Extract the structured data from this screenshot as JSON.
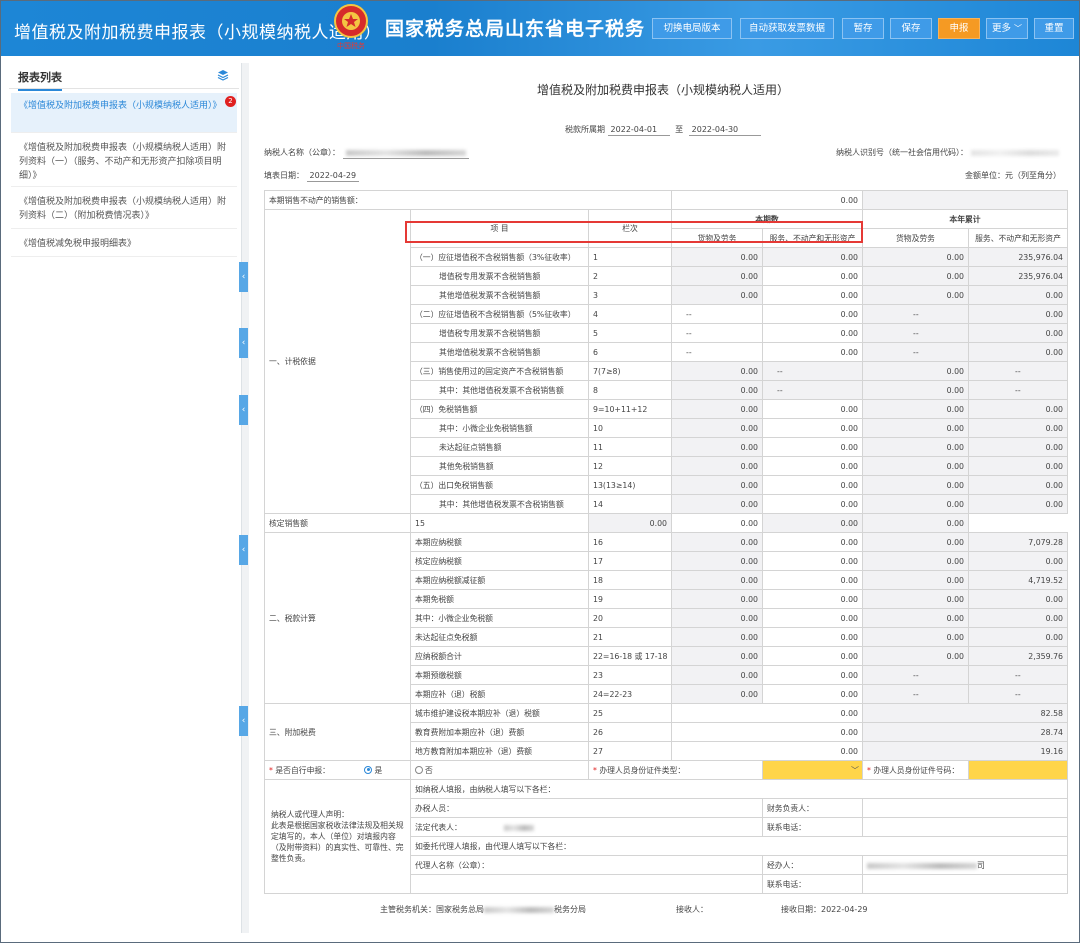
{
  "header": {
    "title": "增值税及附加税费申报表（小规模纳税人适用）",
    "bureau": "国家税务总局山东省电子税务",
    "emblem_text": "中国税务",
    "buttons": [
      "切换电局版本",
      "自动获取发票数据",
      "暂存",
      "保存",
      "申报",
      "更多",
      "重置"
    ]
  },
  "sidebar": {
    "title": "报表列表",
    "badge": "2",
    "items": [
      "《增值税及附加税费申报表（小规模纳税人适用）》",
      "《增值税及附加税费申报表（小规模纳税人适用）附列资料（一）（服务、不动产和无形资产扣除项目明细）》",
      "《增值税及附加税费申报表（小规模纳税人适用）附列资料（二）（附加税费情况表）》",
      "《增值税减免税申报明细表》"
    ]
  },
  "form": {
    "title": "增值税及附加税费申报表（小规模纳税人适用）",
    "period_label": "税款所属期",
    "period_start": "2022-04-01",
    "period_to": "至",
    "period_end": "2022-04-30",
    "taxpayer_name_label": "纳税人名称（公章）：",
    "taxpayer_id_label": "纳税人识别号（统一社会信用代码）：",
    "fill_date_label": "填表日期：",
    "fill_date": "2022-04-29",
    "unit_label": "金额单位：元（列至角分）",
    "real_estate_label": "本期销售不动产的销售额：",
    "real_estate_value": "0.00",
    "head_item": "项 目",
    "head_col": "栏次",
    "head_current": "本期数",
    "head_ytd": "本年累计",
    "sub_goods": "货物及劳务",
    "sub_services": "服务、不动产和无形资产",
    "sec1": "一、计税依据",
    "sec2": "二、税款计算",
    "sec3": "三、附加税费",
    "rows": [
      {
        "label": "（一）应征增值税不含税销售额（3%征收率）",
        "col": "1",
        "c1": "0.00",
        "c2": "0.00",
        "c3": "0.00",
        "c4": "235,976.04"
      },
      {
        "label": "增值税专用发票不含税销售额",
        "col": "2",
        "c1": "0.00",
        "c2": "0.00",
        "c3": "0.00",
        "c4": "235,976.04"
      },
      {
        "label": "其他增值税发票不含税销售额",
        "col": "3",
        "c1": "0.00",
        "c2": "0.00",
        "c3": "0.00",
        "c4": "0.00"
      },
      {
        "label": "（二）应征增值税不含税销售额（5%征收率）",
        "col": "4",
        "c1": "--",
        "c2": "0.00",
        "c3": "--",
        "c4": "0.00"
      },
      {
        "label": "增值税专用发票不含税销售额",
        "col": "5",
        "c1": "--",
        "c2": "0.00",
        "c3": "--",
        "c4": "0.00"
      },
      {
        "label": "其他增值税发票不含税销售额",
        "col": "6",
        "c1": "--",
        "c2": "0.00",
        "c3": "--",
        "c4": "0.00"
      },
      {
        "label": "（三）销售使用过的固定资产不含税销售额",
        "col": "7(7≥8)",
        "c1": "0.00",
        "c2": "--",
        "c3": "0.00",
        "c4": "--"
      },
      {
        "label": "其中：其他增值税发票不含税销售额",
        "col": "8",
        "c1": "0.00",
        "c2": "--",
        "c3": "0.00",
        "c4": "--"
      },
      {
        "label": "（四）免税销售额",
        "col": "9=10+11+12",
        "c1": "0.00",
        "c2": "0.00",
        "c3": "0.00",
        "c4": "0.00"
      },
      {
        "label": "其中：小微企业免税销售额",
        "col": "10",
        "c1": "0.00",
        "c2": "0.00",
        "c3": "0.00",
        "c4": "0.00"
      },
      {
        "label": "未达起征点销售额",
        "col": "11",
        "c1": "0.00",
        "c2": "0.00",
        "c3": "0.00",
        "c4": "0.00"
      },
      {
        "label": "其他免税销售额",
        "col": "12",
        "c1": "0.00",
        "c2": "0.00",
        "c3": "0.00",
        "c4": "0.00"
      },
      {
        "label": "（五）出口免税销售额",
        "col": "13(13≥14)",
        "c1": "0.00",
        "c2": "0.00",
        "c3": "0.00",
        "c4": "0.00"
      },
      {
        "label": "其中：其他增值税发票不含税销售额",
        "col": "14",
        "c1": "0.00",
        "c2": "0.00",
        "c3": "0.00",
        "c4": "0.00"
      },
      {
        "label": "核定销售额",
        "col": "15",
        "c1": "0.00",
        "c2": "0.00",
        "c3": "0.00",
        "c4": "0.00"
      },
      {
        "label": "本期应纳税额",
        "col": "16",
        "c1": "0.00",
        "c2": "0.00",
        "c3": "0.00",
        "c4": "7,079.28"
      },
      {
        "label": "核定应纳税额",
        "col": "17",
        "c1": "0.00",
        "c2": "0.00",
        "c3": "0.00",
        "c4": "0.00"
      },
      {
        "label": "本期应纳税额减征额",
        "col": "18",
        "c1": "0.00",
        "c2": "0.00",
        "c3": "0.00",
        "c4": "4,719.52"
      },
      {
        "label": "本期免税额",
        "col": "19",
        "c1": "0.00",
        "c2": "0.00",
        "c3": "0.00",
        "c4": "0.00"
      },
      {
        "label": "其中：小微企业免税额",
        "col": "20",
        "c1": "0.00",
        "c2": "0.00",
        "c3": "0.00",
        "c4": "0.00"
      },
      {
        "label": "未达起征点免税额",
        "col": "21",
        "c1": "0.00",
        "c2": "0.00",
        "c3": "0.00",
        "c4": "0.00"
      },
      {
        "label": "应纳税额合计",
        "col": "22=16-18 或 17-18",
        "c1": "0.00",
        "c2": "0.00",
        "c3": "0.00",
        "c4": "2,359.76"
      },
      {
        "label": "本期预缴税额",
        "col": "23",
        "c1": "0.00",
        "c2": "0.00",
        "c3": "--",
        "c4": "--"
      },
      {
        "label": "本期应补（退）税额",
        "col": "24=22-23",
        "c1": "0.00",
        "c2": "0.00",
        "c3": "--",
        "c4": "--"
      },
      {
        "label": "城市维护建设税本期应补（退）税额",
        "col": "25",
        "c1": "",
        "c2": "0.00",
        "c3": "",
        "c4": "82.58"
      },
      {
        "label": "教育费附加本期应补（退）费额",
        "col": "26",
        "c1": "",
        "c2": "0.00",
        "c3": "",
        "c4": "28.74"
      },
      {
        "label": "地方教育附加本期应补（退）费额",
        "col": "27",
        "c1": "",
        "c2": "0.00",
        "c3": "",
        "c4": "19.16"
      }
    ],
    "self_filing_label": "是否自行申报：",
    "yes": "是",
    "no": "否",
    "agent_id_type_label": "办理人员身份证件类型：",
    "agent_id_no_label": "办理人员身份证件号码：",
    "star": "*",
    "declaration": "纳税人或代理人声明：\n此表是根据国家税收法律法规及相关规定填写的，本人（单位）对填报内容（及附带资料）的真实性、可靠性、完整性负责。",
    "self_fill_note": "如纳税人填报，由纳税人填写以下各栏：",
    "handler_label": "办税人员：",
    "finance_label": "财务负责人：",
    "legal_label": "法定代表人：",
    "phone_label": "联系电话：",
    "agent_fill_note": "如委托代理人填报，由代理人填写以下各栏：",
    "agent_name_label": "代理人名称（公章）：",
    "operator_label": "经办人：",
    "operator_tail": "司",
    "phone2_label": "联系电话："
  },
  "footer": {
    "authority_label": "主管税务机关：国家税务总局",
    "authority_tail": "税务分局",
    "receiver_label": "接收人：",
    "receive_date_label": "接收日期：",
    "receive_date": "2022-04-29"
  }
}
